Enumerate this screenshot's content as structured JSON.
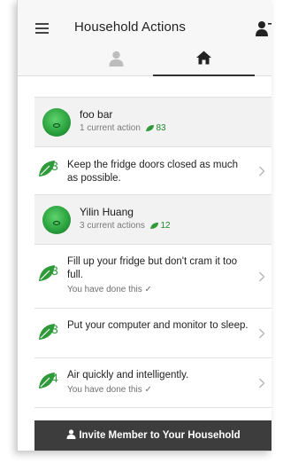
{
  "header": {
    "title": "Household Actions",
    "icons": {
      "menu": "hamburger-menu-icon",
      "add_member": "add-person-icon"
    }
  },
  "tabs": [
    {
      "name": "person-tab",
      "icon": "person-icon",
      "selected": false
    },
    {
      "name": "household-tab",
      "icon": "home-icon",
      "selected": true
    }
  ],
  "members": [
    {
      "name": "foo bar",
      "actions_text": "1 current action",
      "score": "83"
    },
    {
      "name": "Yilin Huang",
      "actions_text": "3 current actions",
      "score": "12"
    }
  ],
  "actions": [
    {
      "points": "3",
      "text": "Keep the fridge doors closed as much as possible.",
      "done_text": ""
    },
    {
      "points": "3",
      "text": "Fill up your fridge but don't cram it too full.",
      "done_text": "You have done this ✓"
    },
    {
      "points": "3",
      "text": "Put your computer and monitor to sleep.",
      "done_text": ""
    },
    {
      "points": "4",
      "text": "Air quickly and intelligently.",
      "done_text": "You have done this ✓"
    }
  ],
  "footer": {
    "invite_label": "Invite Member to Your Household"
  },
  "colors": {
    "accent_green": "#2f9a3a",
    "footer_bg": "#3d3d3d",
    "member_row_bg": "#f2f2f2"
  }
}
